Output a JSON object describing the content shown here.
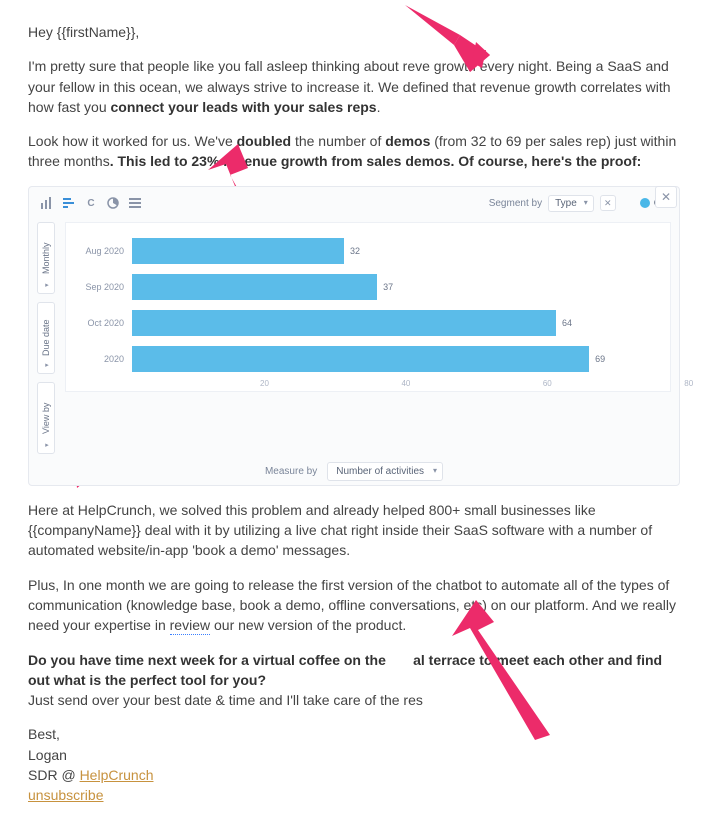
{
  "email": {
    "greeting": "Hey {{firstName}},",
    "p1_a": "I'm pretty sure that people like you fall asleep thinking about reve",
    "p1_b": " growth every night. Being a SaaS and your fellow in this ocean, we always strive to increase it. We defined that revenue growth correlates with how fast you ",
    "p1_bold": "connect your leads with your sales reps",
    "p1_end": ".",
    "p2_a": "Look how it worked for us. We've ",
    "p2_b1": "doubled",
    "p2_b": " the number of ",
    "p2_b2": "demos",
    "p2_c": " (from 32 to 69 per sales rep) just within three months",
    "p2_bold": ". This led to 23% revenue growth from sales demos. Of course, here's the proof:",
    "p3_a": "Here at HelpCrunch, we solved this problem and already helped 800+ small businesses like {{companyName}} deal with it by utilizing a live chat right inside their SaaS software with a number of automated website/in-app 'book a demo' messages.",
    "p4_a": "Plus, In one month we are going to release the first version of the chatbot to automate all of the types of communication (knowledge base, book a demo, offline conversations, etc) on our platform. And we really need your expertise in ",
    "p4_rev": "review",
    "p4_b": " our new version of the product.",
    "p5_bold_a": "Do you have time next week for a virtual coffee on the ",
    "p5_gap": "      ",
    "p5_bold_b": "al terrace to meet each other and find out what is the perfect tool for you?",
    "p5_c": "Just send over your best date & time and I'll take care of the res",
    "sign1": "Best,",
    "sign2": "Logan",
    "sign3a": "SDR @ ",
    "sign3b": "HelpCrunch",
    "unsubscribe": "unsubscribe"
  },
  "chart_ui": {
    "segment_label": "Segment by",
    "segment_value": "Type",
    "call_label": "Call",
    "yctrl": [
      "Monthly",
      "Due date",
      "View by"
    ],
    "measure_label": "Measure by",
    "measure_value": "Number of activities"
  },
  "chart_data": {
    "type": "bar",
    "orientation": "horizontal",
    "title": "",
    "xlabel": "Number of activities",
    "ylabel": "",
    "categories": [
      "Aug 2020",
      "Sep 2020",
      "Oct 2020",
      "2020"
    ],
    "values": [
      32,
      37,
      64,
      69
    ],
    "xlim": [
      0,
      80
    ],
    "xticks": [
      20,
      40,
      60,
      80
    ],
    "series_name": "Call",
    "color": "#5bbce9"
  }
}
